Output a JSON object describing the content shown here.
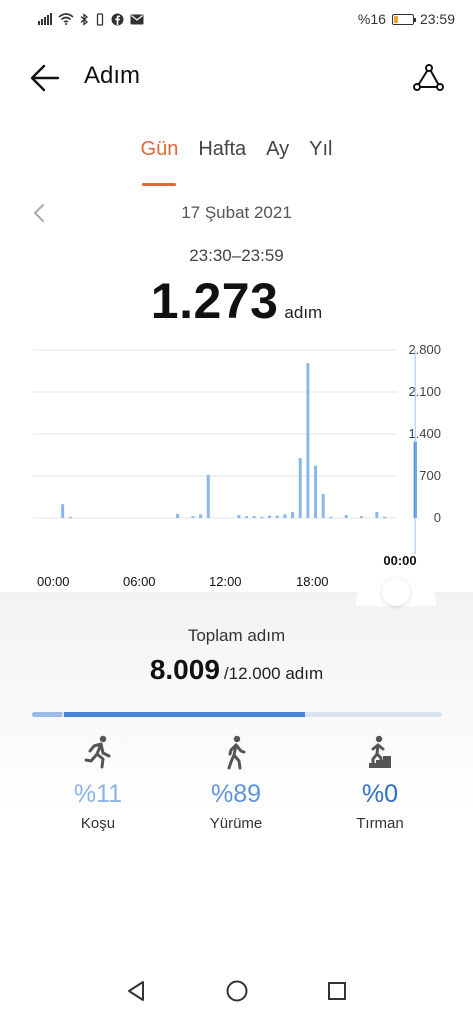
{
  "status_bar": {
    "battery": "%16",
    "time": "23:59"
  },
  "header": {
    "title": "Adım"
  },
  "tabs": [
    {
      "label": "Gün",
      "active": true
    },
    {
      "label": "Hafta",
      "active": false
    },
    {
      "label": "Ay",
      "active": false
    },
    {
      "label": "Yıl",
      "active": false
    }
  ],
  "date": "17 Şubat 2021",
  "selected": {
    "time_range": "23:30–23:59",
    "count": "1.273",
    "unit": "adım",
    "handle_time": "00:00"
  },
  "chart_data": {
    "type": "bar",
    "y_ticks": [
      "2.800",
      "2.100",
      "1.400",
      "700",
      "0"
    ],
    "ylim": [
      0,
      2800
    ],
    "x_ticks": [
      "00:00",
      "06:00",
      "12:00",
      "18:00"
    ],
    "x_unit": "half-hour slot of day (0–47)",
    "bars": [
      {
        "x": 1,
        "y": 230
      },
      {
        "x": 2,
        "y": 20
      },
      {
        "x": 16,
        "y": 70
      },
      {
        "x": 18,
        "y": 30
      },
      {
        "x": 19,
        "y": 60
      },
      {
        "x": 20,
        "y": 720
      },
      {
        "x": 24,
        "y": 50
      },
      {
        "x": 25,
        "y": 30
      },
      {
        "x": 26,
        "y": 30
      },
      {
        "x": 27,
        "y": 20
      },
      {
        "x": 28,
        "y": 40
      },
      {
        "x": 29,
        "y": 40
      },
      {
        "x": 30,
        "y": 60
      },
      {
        "x": 31,
        "y": 100
      },
      {
        "x": 32,
        "y": 1000
      },
      {
        "x": 33,
        "y": 2580
      },
      {
        "x": 34,
        "y": 870
      },
      {
        "x": 35,
        "y": 400
      },
      {
        "x": 36,
        "y": 20
      },
      {
        "x": 38,
        "y": 50
      },
      {
        "x": 40,
        "y": 30
      },
      {
        "x": 42,
        "y": 100
      },
      {
        "x": 43,
        "y": 20
      },
      {
        "x": 47,
        "y": 1273,
        "highlighted": true
      }
    ],
    "colors": {
      "bar": "#8ab8ea",
      "highlight": "#2f7bd6"
    }
  },
  "summary": {
    "label": "Toplam adım",
    "total": "8.009",
    "goal": "/12.000 adım",
    "progress_fraction": 0.667
  },
  "activities": [
    {
      "pct": "%11",
      "label": "Koşu",
      "icon": "running-icon",
      "color": "#8ab4e6"
    },
    {
      "pct": "%89",
      "label": "Yürüme",
      "icon": "walking-icon",
      "color": "#5d93db"
    },
    {
      "pct": "%0",
      "label": "Tırman",
      "icon": "climbing-icon",
      "color": "#2f6fc4"
    }
  ],
  "colors": {
    "accent": "#e2653a",
    "progress_light": "#9bbbe6",
    "progress_dark": "#4a86d6"
  }
}
